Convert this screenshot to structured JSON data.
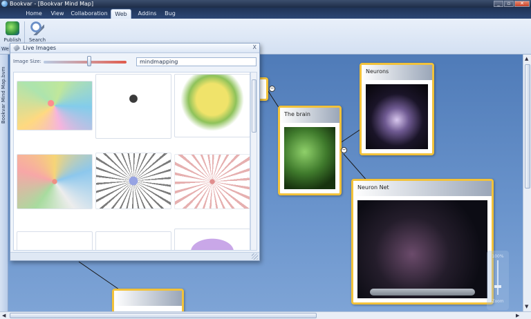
{
  "window": {
    "title": "Bookvar - [Bookvar Mind Map]"
  },
  "tabs": [
    {
      "label": "Home"
    },
    {
      "label": "View"
    },
    {
      "label": "Collaboration"
    },
    {
      "label": "Web"
    },
    {
      "label": "Addins"
    },
    {
      "label": "Bug"
    }
  ],
  "ribbon": {
    "publish_label": "Publish",
    "search_label": "Search",
    "group_label": "We"
  },
  "sidebar": {
    "tab_label": "Bookvar Mind Map.bvm"
  },
  "live_images": {
    "title": "Live Images",
    "close_label": "X",
    "image_size_label": "Image Size:",
    "image_size_value": 0.55,
    "search_value": "mindmapping"
  },
  "nodes": {
    "brain": {
      "label": "The brain"
    },
    "neurons": {
      "label": "Neurons"
    },
    "neuron_net": {
      "label": "Neuron Net"
    },
    "collapse_symbol": "−"
  },
  "zoom": {
    "value_label": "100%",
    "label": "Zoom"
  },
  "icons": [
    "publish-icon",
    "search-icon",
    "pin-icon",
    "close-icon",
    "scroll-up-icon",
    "scroll-down-icon",
    "scroll-left-icon",
    "scroll-right-icon"
  ]
}
